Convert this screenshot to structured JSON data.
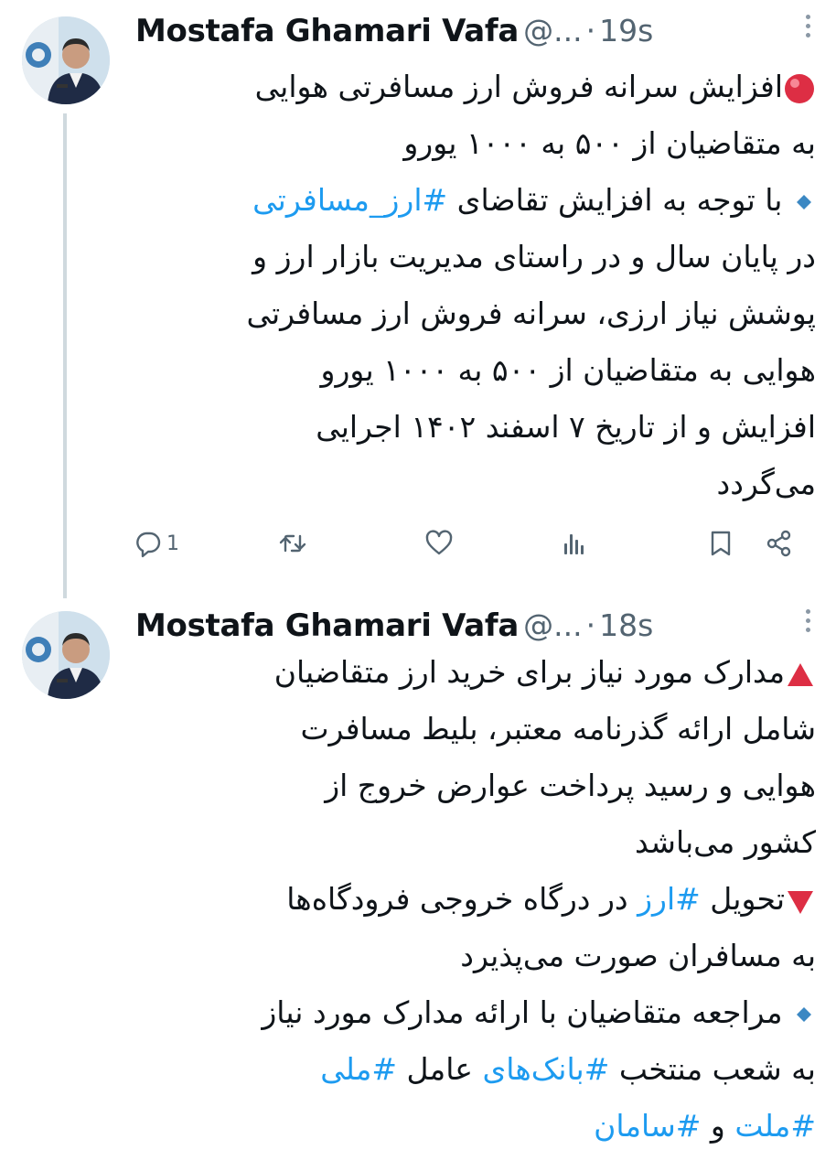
{
  "tweets": [
    {
      "author": {
        "name": "Mostafa Ghamari Vafa",
        "handle": "@...",
        "time": "19s"
      },
      "lines": [
        {
          "emoji": "red-circle",
          "text": "افزایش سرانه فروش ارز مسافرتی هوایی"
        },
        {
          "text": "به متقاضیان از ۵۰۰ به ۱۰۰۰ یورو"
        },
        {
          "emoji": "blue-diamond",
          "text": "با توجه به افزایش تقاضای ",
          "hashtag": "#ارز_مسافرتی"
        },
        {
          "text": "در پایان سال و در راستای مدیریت بازار ارز و"
        },
        {
          "text": "پوشش نیاز ارزی، سرانه فروش ارز مسافرتی"
        },
        {
          "text": "هوایی به متقاضیان از ۵۰۰ به ۱۰۰۰ یورو"
        },
        {
          "text": "افزایش و از تاریخ ۷ اسفند ۱۴۰۲ اجرایی"
        },
        {
          "text": "می‌گردد"
        }
      ],
      "actions": {
        "reply_count": "1"
      }
    },
    {
      "author": {
        "name": "Mostafa Ghamari Vafa",
        "handle": "@...",
        "time": "18s"
      },
      "lines": [
        {
          "emoji": "red-triangle-up",
          "text": "مدارک مورد نیاز برای خرید ارز متقاضیان"
        },
        {
          "text": "شامل ارائه گذرنامه معتبر، بلیط مسافرت"
        },
        {
          "text": "هوایی و رسید پرداخت عوارض خروج از"
        },
        {
          "text": "کشور می‌باشد"
        },
        {
          "emoji": "red-triangle-down",
          "text_before": "تحویل ",
          "hashtag": "#ارز",
          "text": " در درگاه خروجی فرودگاه‌ها"
        },
        {
          "text": "به مسافران صورت می‌پذیرد"
        },
        {
          "emoji": "blue-diamond",
          "text": "مراجعه متقاضیان با ارائه مدارک مورد نیاز"
        },
        {
          "text_before": "به شعب منتخب ",
          "hashtag": "#بانک‌های",
          "text": " عامل ",
          "hashtag2": "#ملی"
        },
        {
          "hashtag": "#ملت",
          "text": " و ",
          "hashtag2": "#سامان"
        }
      ]
    }
  ],
  "icons": [
    "reply-icon",
    "retweet-icon",
    "like-icon",
    "views-icon",
    "bookmark-icon",
    "share-icon",
    "more-icon"
  ],
  "colors": {
    "text": "#0f1419",
    "secondary": "#536471",
    "hashtag": "#1d9bf0",
    "thread_line": "#cfd9de"
  }
}
